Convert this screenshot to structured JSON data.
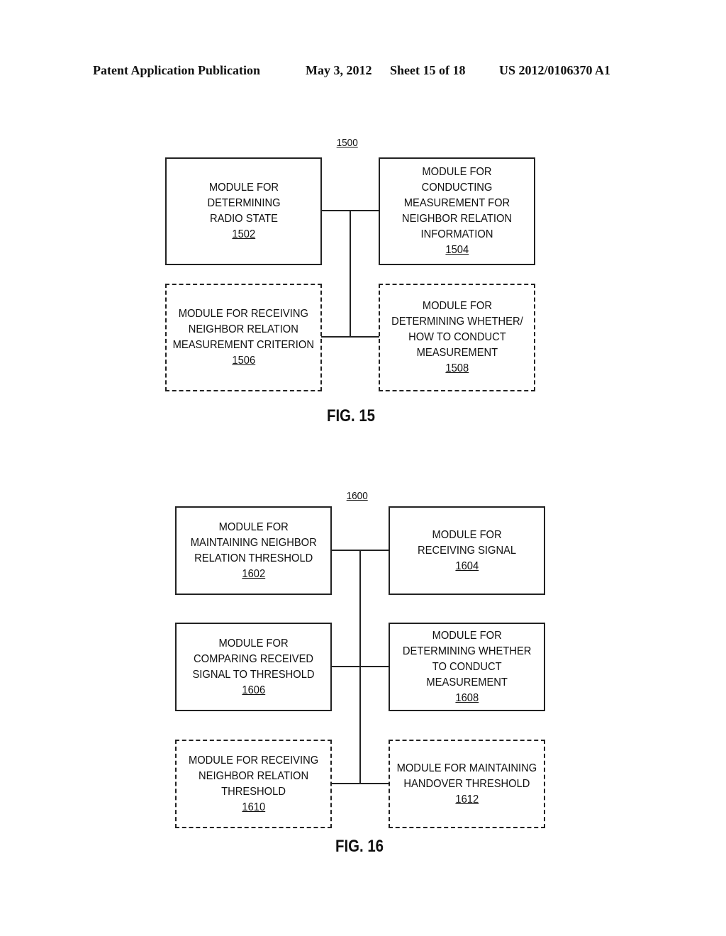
{
  "header": {
    "publication": "Patent Application Publication",
    "date": "May 3, 2012",
    "sheet": "Sheet 15 of 18",
    "number": "US 2012/0106370 A1"
  },
  "fig15": {
    "ref": "1500",
    "caption": "FIG. 15",
    "modules": [
      {
        "label": "MODULE FOR\nDETERMINING\nRADIO STATE",
        "num": "1502",
        "style": "solid"
      },
      {
        "label": "MODULE FOR CONDUCTING\nMEASUREMENT FOR\nNEIGHBOR RELATION\nINFORMATION",
        "num": "1504",
        "style": "solid"
      },
      {
        "label": "MODULE FOR RECEIVING\nNEIGHBOR RELATION\nMEASUREMENT CRITERION",
        "num": "1506",
        "style": "dashed"
      },
      {
        "label": "MODULE FOR\nDETERMINING WHETHER/\nHOW TO CONDUCT\nMEASUREMENT",
        "num": "1508",
        "style": "dashed"
      }
    ]
  },
  "fig16": {
    "ref": "1600",
    "caption": "FIG. 16",
    "modules": [
      {
        "label": "MODULE FOR\nMAINTAINING NEIGHBOR\nRELATION THRESHOLD",
        "num": "1602",
        "style": "solid"
      },
      {
        "label": "MODULE FOR\nRECEIVING SIGNAL",
        "num": "1604",
        "style": "solid"
      },
      {
        "label": "MODULE FOR\nCOMPARING RECEIVED\nSIGNAL TO THRESHOLD",
        "num": "1606",
        "style": "solid"
      },
      {
        "label": "MODULE FOR\nDETERMINING WHETHER\nTO CONDUCT\nMEASUREMENT",
        "num": "1608",
        "style": "solid"
      },
      {
        "label": "MODULE FOR RECEIVING\nNEIGHBOR RELATION\nTHRESHOLD",
        "num": "1610",
        "style": "dashed"
      },
      {
        "label": "MODULE FOR MAINTAINING\nHANDOVER THRESHOLD",
        "num": "1612",
        "style": "dashed"
      }
    ]
  }
}
